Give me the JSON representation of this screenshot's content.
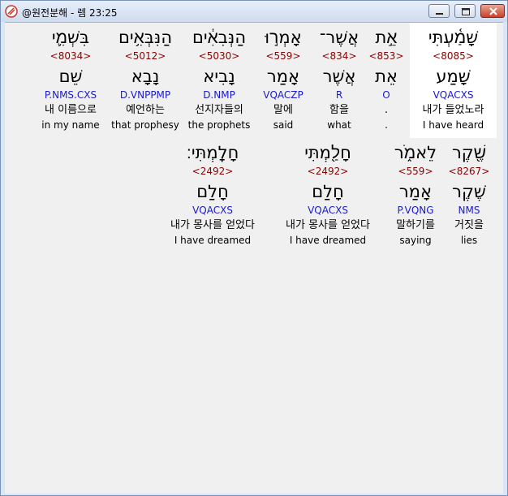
{
  "window": {
    "title": "@원전분해 - 렘 23:25"
  },
  "row1": [
    {
      "heb": "שָׁמַ֫עְתִּי",
      "num": "<8085>",
      "lemma": "שָׁמַע",
      "morph": "VQACXS",
      "kor": "내가 들었노라",
      "eng": "I have heard"
    },
    {
      "heb": "אֵ֣ת",
      "num": "<853>",
      "lemma": "אֵת",
      "morph": "O",
      "kor": ".",
      "eng": "."
    },
    {
      "heb": "אֲשֶׁר־",
      "num": "<834>",
      "lemma": "אֲשֶׁר",
      "morph": "R",
      "kor": "함을",
      "eng": "what"
    },
    {
      "heb": "אָמְר֣וּ",
      "num": "<559>",
      "lemma": "אָמַר",
      "morph": "VQACZP",
      "kor": "말에",
      "eng": "said"
    },
    {
      "heb": "הַנְּבִאִ֔ים",
      "num": "<5030>",
      "lemma": "נָבִיא",
      "morph": "D.NMP",
      "kor": "선지자들의",
      "eng": "the prophets"
    },
    {
      "heb": "הַנִּבְּאִ֥ים",
      "num": "<5012>",
      "lemma": "נָבָא",
      "morph": "D.VNPPMP",
      "kor": "예언하는",
      "eng": "that prophesy"
    },
    {
      "heb": "בִּשְׁמִ֛י",
      "num": "<8034>",
      "lemma": "שֵׁם",
      "morph": "P.NMS.CXS",
      "kor": "내 이름으로",
      "eng": "in my name"
    }
  ],
  "row2": [
    {
      "heb": "שֶׁ֖קֶר",
      "num": "<8267>",
      "lemma": "שֶׁקֶר",
      "morph": "NMS",
      "kor": "거짓을",
      "eng": "lies"
    },
    {
      "heb": "לֵאמֹ֑ר",
      "num": "<559>",
      "lemma": "אָמַר",
      "morph": "P.VQNG",
      "kor": "말하기를",
      "eng": "saying"
    },
    {
      "heb": "חָלַ֖מְתִּי",
      "num": "<2492>",
      "lemma": "חָלַם",
      "morph": "VQACXS",
      "kor": "내가 몽사를 얻었다",
      "eng": "I have dreamed"
    },
    {
      "heb": "חָלָֽמְתִּי׃",
      "num": "<2492>",
      "lemma": "חָלַם",
      "morph": "VQACXS",
      "kor": "내가 몽사를 얻었다",
      "eng": "I have dreamed"
    }
  ]
}
